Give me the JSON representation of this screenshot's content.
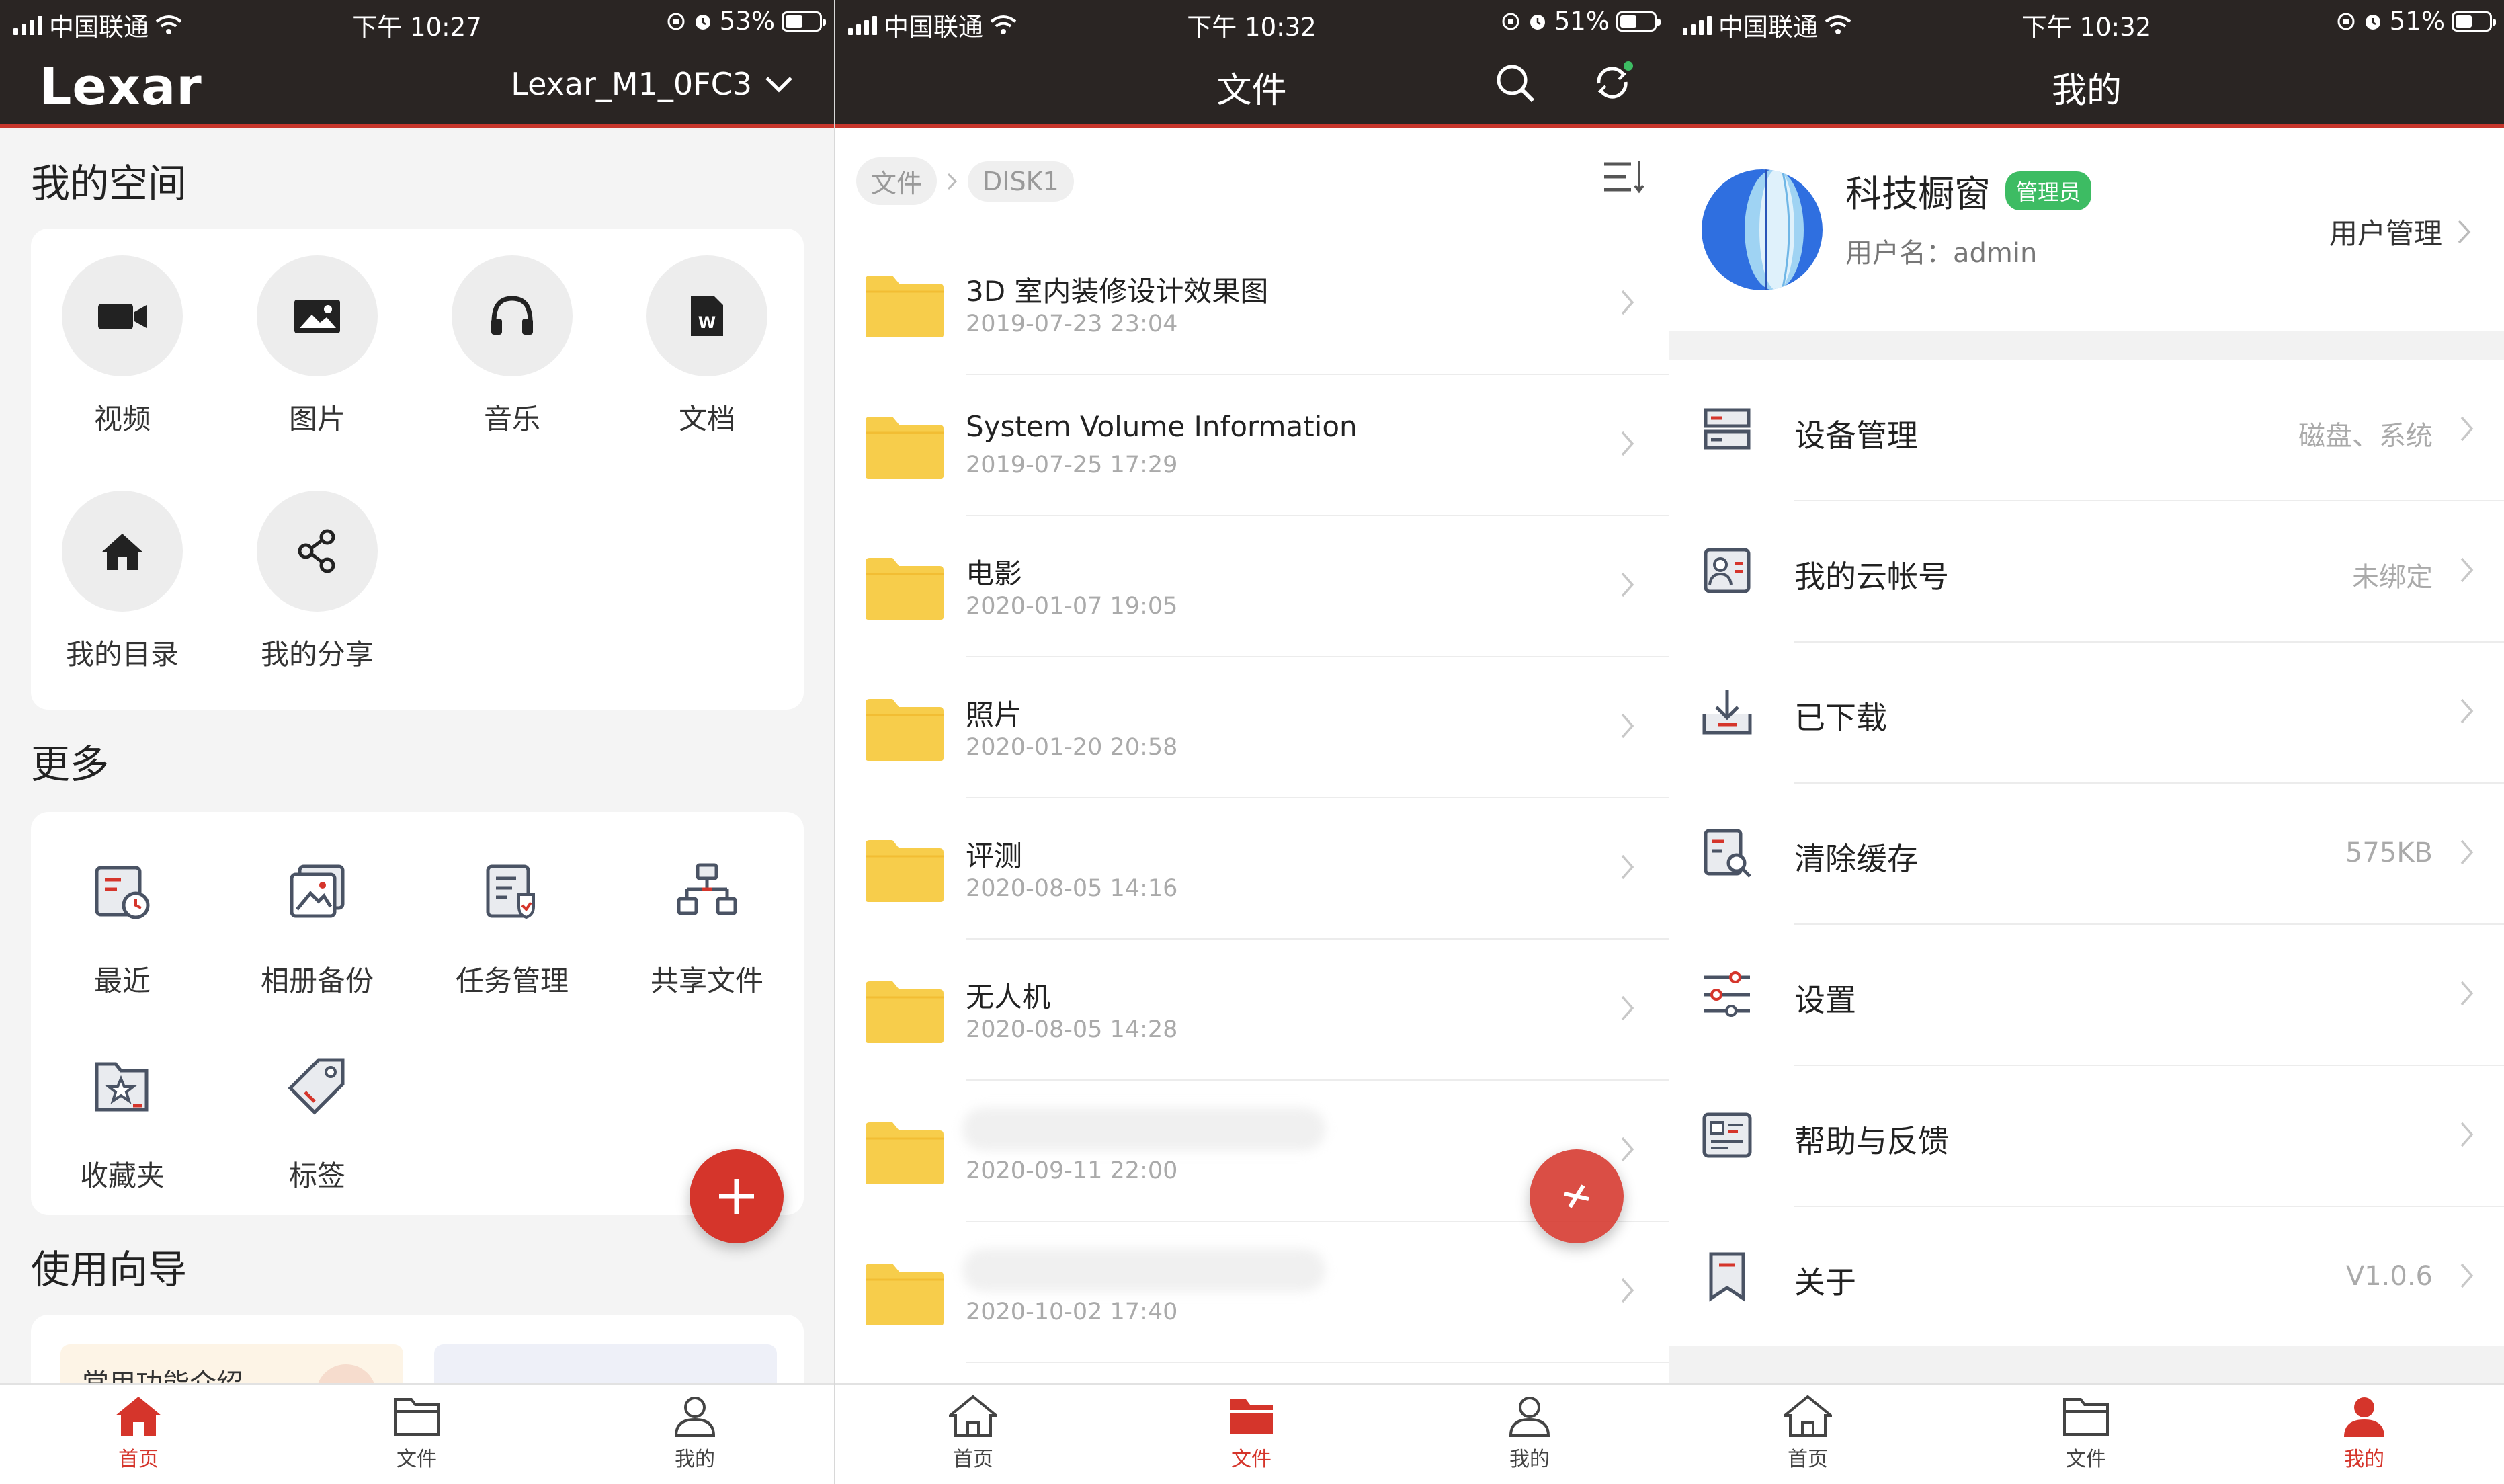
{
  "status_bars": [
    {
      "carrier": "中国联通",
      "time": "下午 10:27",
      "battery": "53%",
      "battery_level": 0.53
    },
    {
      "carrier": "中国联通",
      "time": "下午 10:32",
      "battery": "51%",
      "battery_level": 0.51
    },
    {
      "carrier": "中国联通",
      "time": "下午 10:32",
      "battery": "51%",
      "battery_level": 0.51
    }
  ],
  "home": {
    "logo": "Lexar",
    "device": "Lexar_M1_0FC3",
    "my_space_title": "我的空间",
    "my_space_items": [
      {
        "label": "视频",
        "icon": "video-camera-icon"
      },
      {
        "label": "图片",
        "icon": "image-icon"
      },
      {
        "label": "音乐",
        "icon": "headphones-icon"
      },
      {
        "label": "文档",
        "icon": "word-document-icon"
      },
      {
        "label": "我的目录",
        "icon": "home-icon"
      },
      {
        "label": "我的分享",
        "icon": "share-icon"
      }
    ],
    "more_title": "更多",
    "more_items": [
      {
        "label": "最近",
        "icon": "recent-clock-icon"
      },
      {
        "label": "相册备份",
        "icon": "album-backup-icon"
      },
      {
        "label": "任务管理",
        "icon": "task-manager-icon"
      },
      {
        "label": "共享文件",
        "icon": "shared-files-icon"
      },
      {
        "label": "收藏夹",
        "icon": "favorites-icon"
      },
      {
        "label": "标签",
        "icon": "tag-icon"
      }
    ],
    "guide_title": "使用向导",
    "guide_card_label": "常用功能介绍"
  },
  "files": {
    "title": "文件",
    "breadcrumb": [
      "文件",
      "DISK1"
    ],
    "rows": [
      {
        "name": "3D 室内装修设计效果图",
        "date": "2019-07-23 23:04"
      },
      {
        "name": "System Volume Information",
        "date": "2019-07-25 17:29"
      },
      {
        "name": "电影",
        "date": "2020-01-07 19:05"
      },
      {
        "name": "照片",
        "date": "2020-01-20 20:58"
      },
      {
        "name": "评测",
        "date": "2020-08-05 14:16"
      },
      {
        "name": "无人机",
        "date": "2020-08-05 14:28"
      },
      {
        "name": "",
        "date": "2020-09-11 22:00"
      },
      {
        "name": "",
        "date": "2020-10-02 17:40"
      }
    ]
  },
  "profile": {
    "title": "我的",
    "display_name": "科技橱窗",
    "role_badge": "管理员",
    "username_label": "用户名：",
    "username": "admin",
    "user_management": "用户管理",
    "menu": [
      {
        "label": "设备管理",
        "value": "磁盘、系统",
        "icon": "device-management-icon"
      },
      {
        "label": "我的云帐号",
        "value": "未绑定",
        "icon": "cloud-account-icon"
      },
      {
        "label": "已下载",
        "value": "",
        "icon": "downloaded-icon"
      },
      {
        "label": "清除缓存",
        "value": "575KB",
        "icon": "clear-cache-icon"
      },
      {
        "label": "设置",
        "value": "",
        "icon": "settings-sliders-icon"
      },
      {
        "label": "帮助与反馈",
        "value": "",
        "icon": "help-feedback-icon"
      },
      {
        "label": "关于",
        "value": "V1.0.6",
        "icon": "about-bookmark-icon"
      }
    ]
  },
  "tabbar": {
    "home": "首页",
    "files": "文件",
    "me": "我的"
  },
  "colors": {
    "accent": "#d5352b",
    "header": "#2a2523",
    "folder": "#f7cd4b",
    "badge": "#3dbc63"
  }
}
